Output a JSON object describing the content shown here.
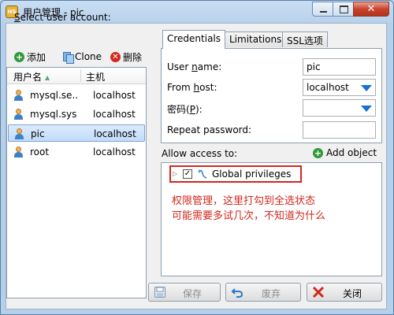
{
  "window": {
    "title": "用户管理 - pic",
    "app_icon_text": "HS"
  },
  "left": {
    "select_label_u": "S",
    "select_label_rest": "elect user account:",
    "toolbar": {
      "add": "添加",
      "clone": "Clone",
      "delete": "删除"
    },
    "columns": [
      "用户名",
      "主机"
    ],
    "users": [
      {
        "name": "mysql.se...",
        "host": "localhost"
      },
      {
        "name": "mysql.sys",
        "host": "localhost"
      },
      {
        "name": "pic",
        "host": "localhost",
        "selected": true
      },
      {
        "name": "root",
        "host": "localhost"
      }
    ]
  },
  "tabs": [
    "Credentials",
    "Limitations",
    "SSL选项"
  ],
  "credentials": {
    "user_name_label_pre": "User ",
    "user_name_label_u": "n",
    "user_name_label_post": "ame:",
    "user_name_value": "pic",
    "from_host_label_pre": "From ",
    "from_host_label_u": "h",
    "from_host_label_post": "ost:",
    "from_host_value": "localhost",
    "password_label_pre": "密码(",
    "password_label_u": "P",
    "password_label_post": "):",
    "password_value": "",
    "repeat_password_label": "Repeat password:",
    "repeat_password_value": ""
  },
  "access": {
    "label": "Allow access to:",
    "add_object": "Add object",
    "tree_item": "Global privileges",
    "note_line1": "权限管理，这里打勾到全选状态",
    "note_line2": "可能需要多试几次，不知道为什么"
  },
  "buttons": {
    "save": "保存",
    "discard": "废弃",
    "close": "关闭"
  },
  "colors": {
    "annotation": "#d0271d",
    "accent_blue": "#1b6fd1",
    "add_green": "#2f9a3a"
  }
}
